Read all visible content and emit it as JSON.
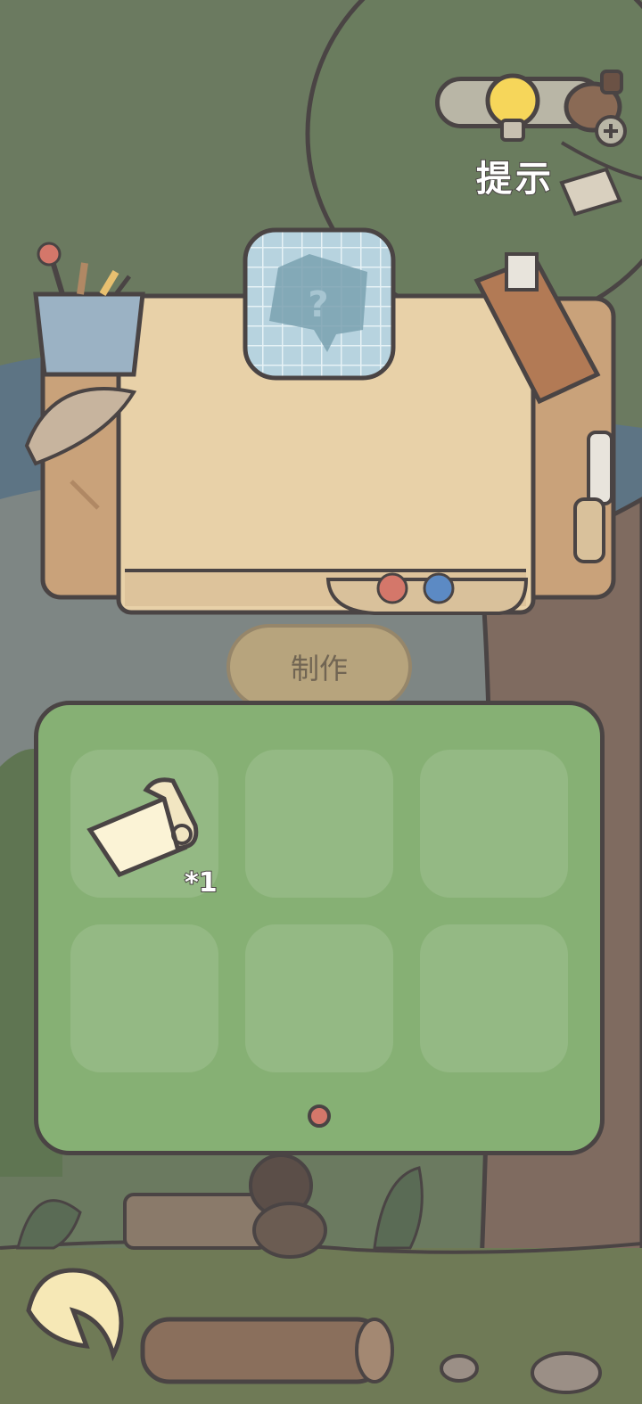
{
  "hud": {
    "hint_label": "提示",
    "hint_icon": "lightbulb-icon",
    "add_icon": "plus-icon"
  },
  "workbench": {
    "result_slot_icon": "unknown-item-icon",
    "result_slot_glyph": "?"
  },
  "craft": {
    "button_label": "制作"
  },
  "inventory": {
    "items": [
      {
        "icon": "paper-scroll-icon",
        "count_label": "*1"
      }
    ],
    "page_dots": 1
  },
  "nav": {
    "back_icon": "back-arrow-icon"
  },
  "colors": {
    "panel": "#86b074",
    "table_top": "#e8d1a8",
    "wood": "#c9a27a",
    "outline": "#4a4444",
    "dot": "#d4776a"
  }
}
